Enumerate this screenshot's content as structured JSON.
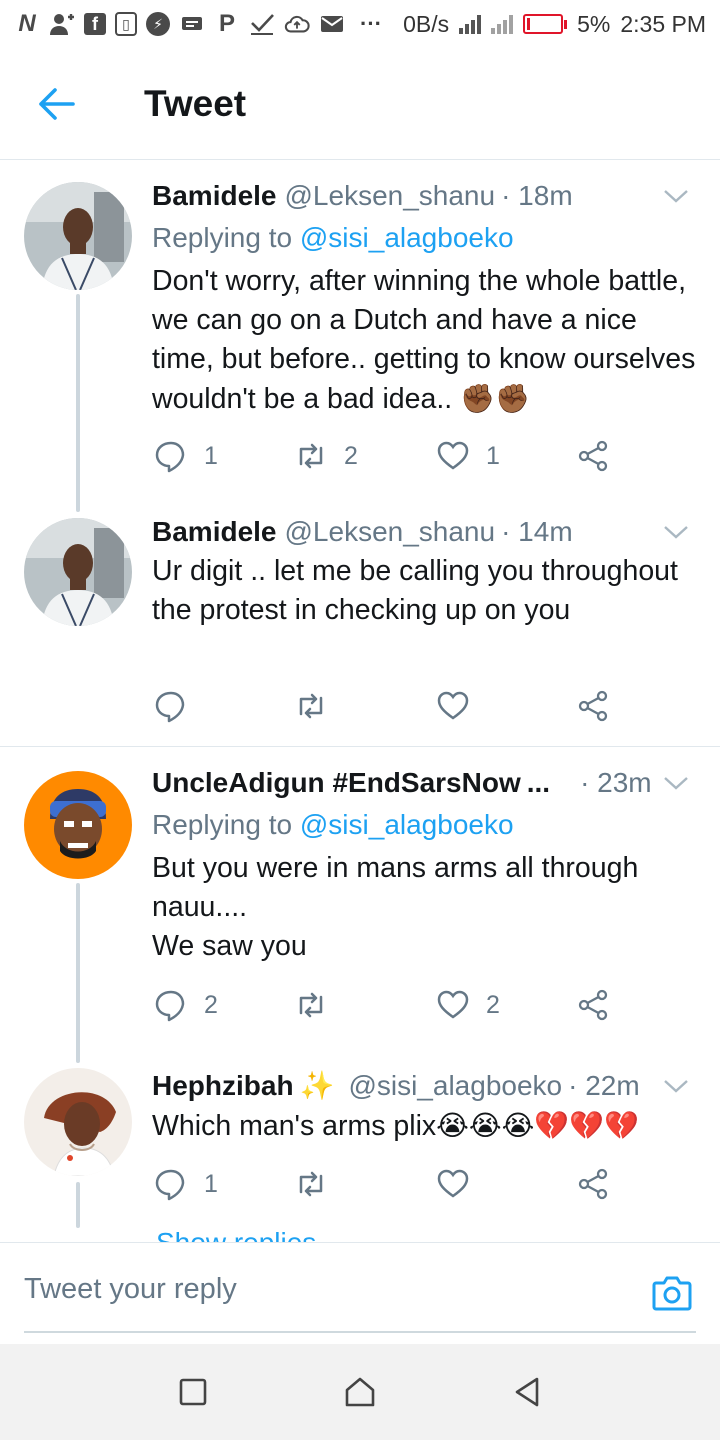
{
  "status_bar": {
    "left_icons": [
      "N",
      "user-add-icon",
      "F",
      "sim-icon",
      "messenger-icon",
      "message-icon",
      "P",
      "check-icon",
      "cloud-upload-icon",
      "mail-icon"
    ],
    "more": "···",
    "net_speed": "0B/s",
    "battery": "5%",
    "time": "2:35 PM",
    "battery_color": "#e0152a"
  },
  "header": {
    "title": "Tweet",
    "accent": "#1da1f2"
  },
  "tweets": [
    {
      "name": "Bamidele",
      "handle": "@Leksen_shanu",
      "time": "· 18m",
      "replying_prefix": "Replying to ",
      "replying_to": "@sisi_alagboeko",
      "text": "Don't worry, after winning the whole battle, we can go on a Dutch and have a nice time, but before.. getting to know ourselves wouldn't be a bad idea.. ",
      "emoji": "✊🏾✊🏾",
      "replies": "1",
      "retweets": "2",
      "likes": "1"
    },
    {
      "name": "Bamidele",
      "handle": "@Leksen_shanu",
      "time": "· 14m",
      "text": "Ur digit .. let me be calling you throughout the protest in checking up on you",
      "replies": "",
      "retweets": "",
      "likes": ""
    },
    {
      "name": "UncleAdigun #EndSarsNow",
      "ellipsis": "...",
      "time": "· 23m",
      "replying_prefix": "Replying to ",
      "replying_to": "@sisi_alagboeko",
      "text": "But you were in mans arms all through nauu....\nWe saw you",
      "replies": "2",
      "retweets": "",
      "likes": "2"
    },
    {
      "name": "Hephzibah",
      "name_emoji": "✨",
      "handle": "@sisi_alagboeko",
      "time": "· 22m",
      "text": "Which man's arms plix",
      "emoji": "😭😭😭💔💔💔",
      "replies": "1",
      "retweets": "",
      "likes": ""
    }
  ],
  "show_replies": "Show replies",
  "reply_bar": {
    "placeholder": "Tweet your reply"
  },
  "nav_bar": {
    "buttons": [
      "recents-square-icon",
      "home-icon",
      "back-triangle-icon"
    ]
  }
}
